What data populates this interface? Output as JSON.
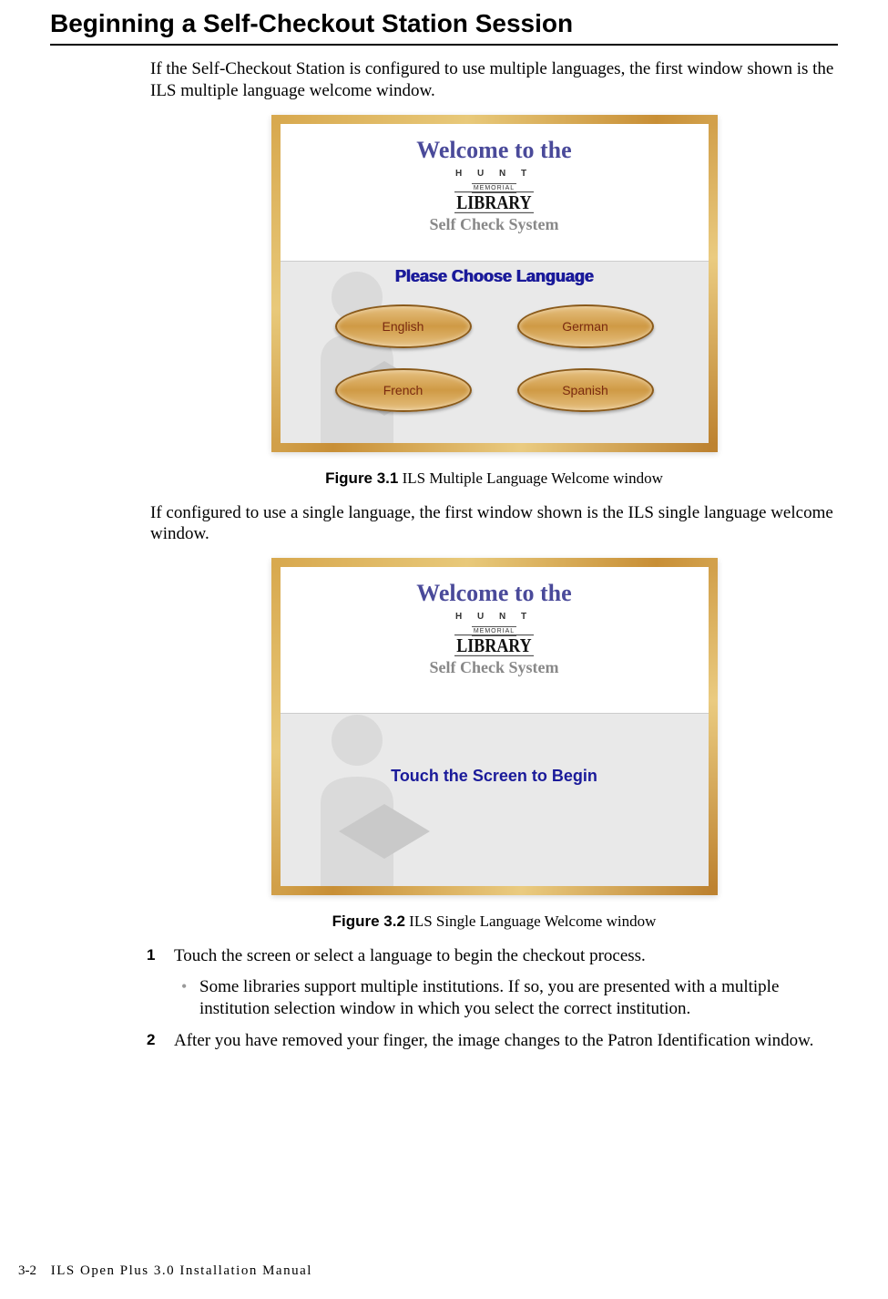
{
  "heading": "Beginning a Self-Checkout Station Session",
  "intro1": "If the Self-Checkout Station is configured to use multiple languages, the first window shown is the ILS multiple language welcome window.",
  "intro2": "If configured to use a single language, the first window shown is the ILS single language welcome window.",
  "screenshot": {
    "welcome_title": "Welcome to the",
    "logo_top": "H U N T",
    "logo_mid": "MEMORIAL",
    "logo_bottom": "LIBRARY",
    "subtitle": "Self Check System",
    "choose_lang": "Please Choose Language",
    "langs": [
      "English",
      "German",
      "French",
      "Spanish"
    ],
    "touch_begin": "Touch the Screen to Begin"
  },
  "figure1": {
    "label": "Figure 3.1",
    "caption": " ILS Multiple Language Welcome window"
  },
  "figure2": {
    "label": "Figure 3.2",
    "caption": " ILS Single Language Welcome window"
  },
  "steps": {
    "s1": "Touch the screen or select a language to begin the checkout process.",
    "s1_sub": "Some libraries support multiple institutions. If so, you are presented with a multiple institution selection window in which you select the correct institution.",
    "s2": "After you have removed your finger, the image changes to the Patron Identification window."
  },
  "footer": {
    "page": "3-2",
    "title": "ILS Open Plus 3.0 Installation Manual"
  }
}
